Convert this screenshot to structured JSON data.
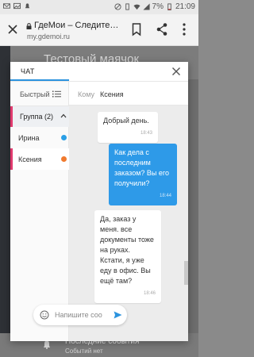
{
  "status_bar": {
    "time": "21:09",
    "battery": "7%"
  },
  "browser": {
    "title": "ГдеМои – Следите…",
    "url": "my.gdemoi.ru"
  },
  "background": {
    "title": "Тестовый маячок",
    "bottom_title": "Последние события",
    "bottom_subtitle": "Событий нет"
  },
  "chat": {
    "tab_label": "ЧАТ",
    "search_placeholder": "Быстрый",
    "group_label": "Группа (2)",
    "contacts": [
      {
        "name": "Ирина",
        "dot_color": "#2b9fe6"
      },
      {
        "name": "Ксения",
        "dot_color": "#f07a2e"
      }
    ],
    "to_label": "Кому",
    "to_value": "Ксения",
    "messages": [
      {
        "text": "Добрый день.",
        "time": "18:43",
        "direction": "in"
      },
      {
        "text": "Как дела с последним заказом? Вы его получили?",
        "time": "18:44",
        "direction": "out"
      },
      {
        "text": "Да, заказ у меня. все документы тоже на руках. Кстати, я уже еду в офис. Вы ещё там?",
        "time": "18:46",
        "direction": "in"
      }
    ],
    "input_placeholder": "Напишите сообщение"
  },
  "colors": {
    "accent": "#2b93de",
    "selection": "#e03a6e",
    "outgoing_bubble": "#2e9ae8"
  }
}
